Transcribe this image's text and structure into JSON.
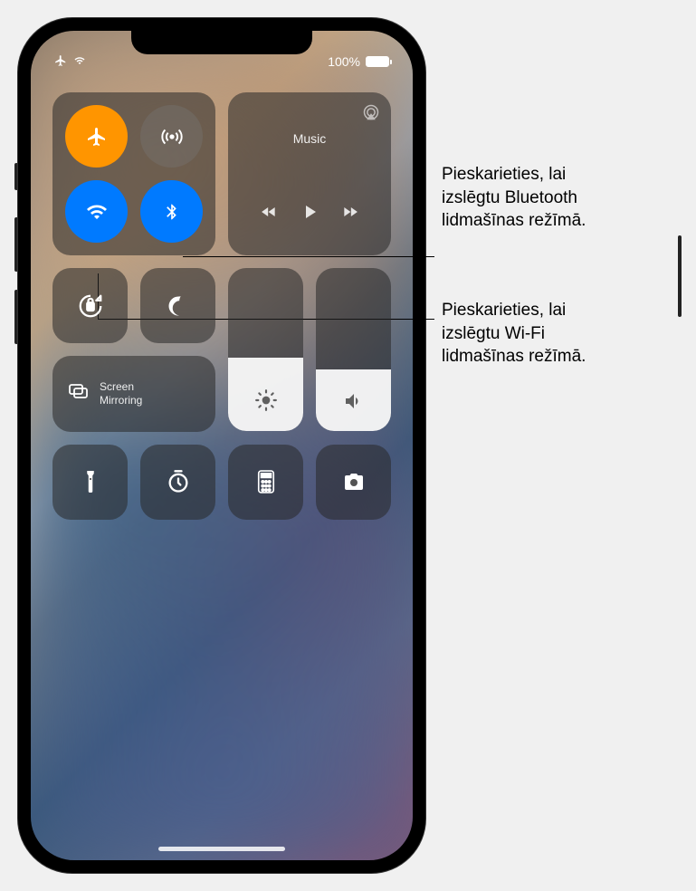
{
  "status": {
    "battery_percent": "100%"
  },
  "connectivity": {
    "airplane": {
      "active": true
    },
    "cellular": {
      "active": false
    },
    "wifi": {
      "active": true
    },
    "bluetooth": {
      "active": true
    }
  },
  "music": {
    "label": "Music"
  },
  "screen_mirroring": {
    "label": "Screen\nMirroring"
  },
  "sliders": {
    "brightness_percent": 45,
    "volume_percent": 38
  },
  "callouts": {
    "bluetooth": "Pieskarieties, lai\nizslēgtu Bluetooth\nlidmašīnas režīmā.",
    "wifi": "Pieskarieties, lai\nizslēgtu Wi-Fi\nlidmašīnas režīmā."
  }
}
